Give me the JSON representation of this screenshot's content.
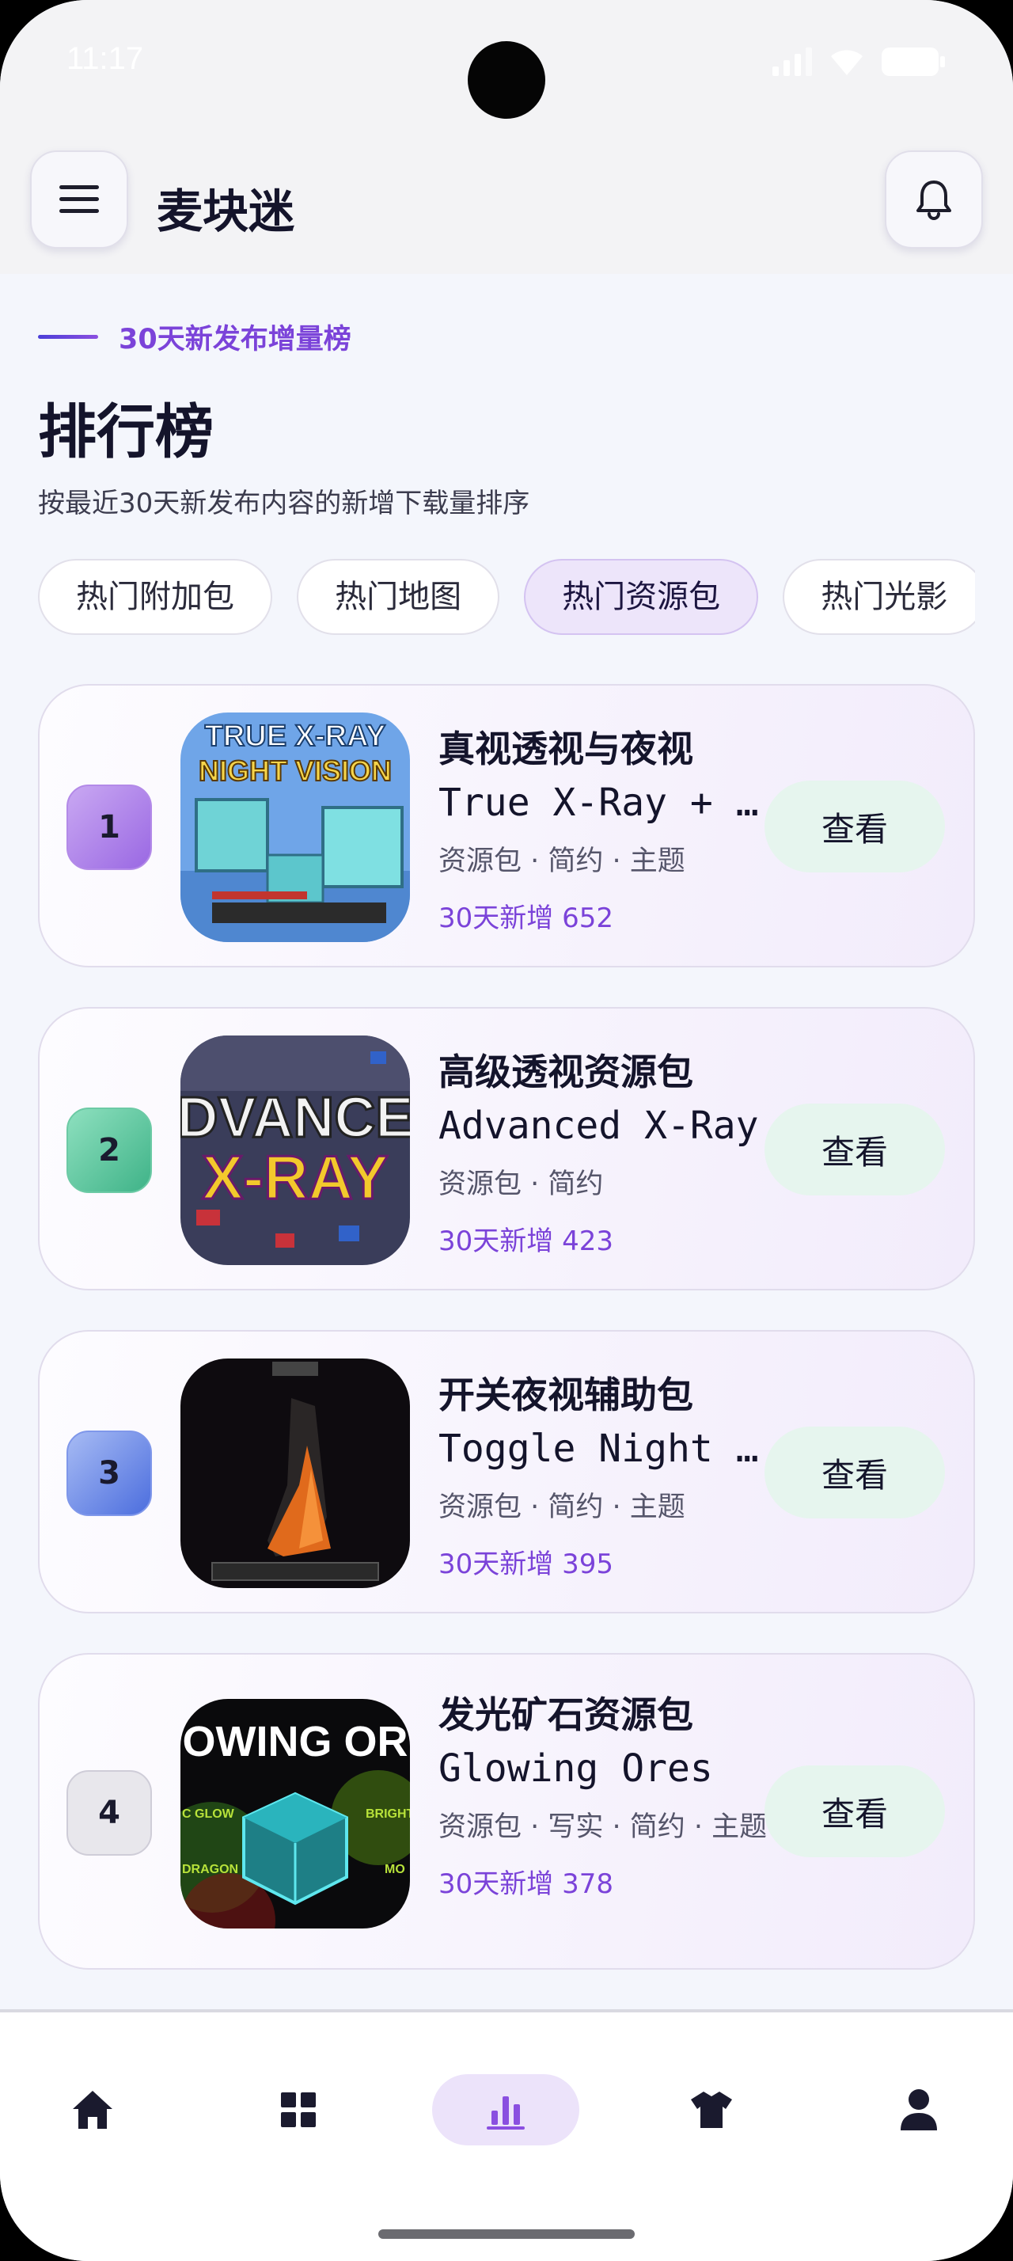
{
  "status_bar": {
    "time": "11:17"
  },
  "app_bar": {
    "title": "麦块迷",
    "menu_icon": "hamburger-icon",
    "bell_icon": "bell-icon"
  },
  "header": {
    "eyebrow": "30天新发布增量榜",
    "title": "排行榜",
    "subtitle": "按最近30天新发布内容的新增下载量排序"
  },
  "tabs": [
    {
      "label": "热门附加包",
      "active": false
    },
    {
      "label": "热门地图",
      "active": false
    },
    {
      "label": "热门资源包",
      "active": true
    },
    {
      "label": "热门光影",
      "active": false
    }
  ],
  "items": [
    {
      "rank": "1",
      "name_cn": "真视透视与夜视",
      "name_en": "True X-Ray + Night Vision",
      "tags": "资源包 · 简约 · 主题",
      "growth": "30天新增 652",
      "button": "查看",
      "thumb_text_1": "TRUE X-RAY",
      "thumb_text_2": "NIGHT VISION",
      "rank_color": "#a77be8"
    },
    {
      "rank": "2",
      "name_cn": "高级透视资源包",
      "name_en": "Advanced X-Ray",
      "tags": "资源包 · 简约",
      "growth": "30天新增 423",
      "button": "查看",
      "thumb_text_1": "DVANCE",
      "thumb_text_2": "X-RAY",
      "rank_color": "#4fbf98"
    },
    {
      "rank": "3",
      "name_cn": "开关夜视辅助包",
      "name_en": "Toggle Night Vision",
      "tags": "资源包 · 简约 · 主题",
      "growth": "30天新增 395",
      "button": "查看",
      "thumb_text_1": "",
      "thumb_text_2": "",
      "rank_color": "#5b7ae6"
    },
    {
      "rank": "4",
      "name_cn": "发光矿石资源包",
      "name_en": "Glowing Ores",
      "tags": "资源包 · 写实 · 简约 · 主题",
      "growth": "30天新增 378",
      "button": "查看",
      "thumb_text_1": "OWING OR",
      "thumb_text_2": "C GLOW",
      "thumb_text_3": "DRAGON",
      "thumb_text_4": "BRIGHT",
      "thumb_text_5": "MO",
      "rank_color": "#e3e3e8"
    }
  ],
  "bottom_nav": [
    {
      "icon": "home-icon",
      "active": false
    },
    {
      "icon": "grid-icon",
      "active": false
    },
    {
      "icon": "bar-chart-icon",
      "active": true
    },
    {
      "icon": "shirt-icon",
      "active": false
    },
    {
      "icon": "user-icon",
      "active": false
    }
  ]
}
